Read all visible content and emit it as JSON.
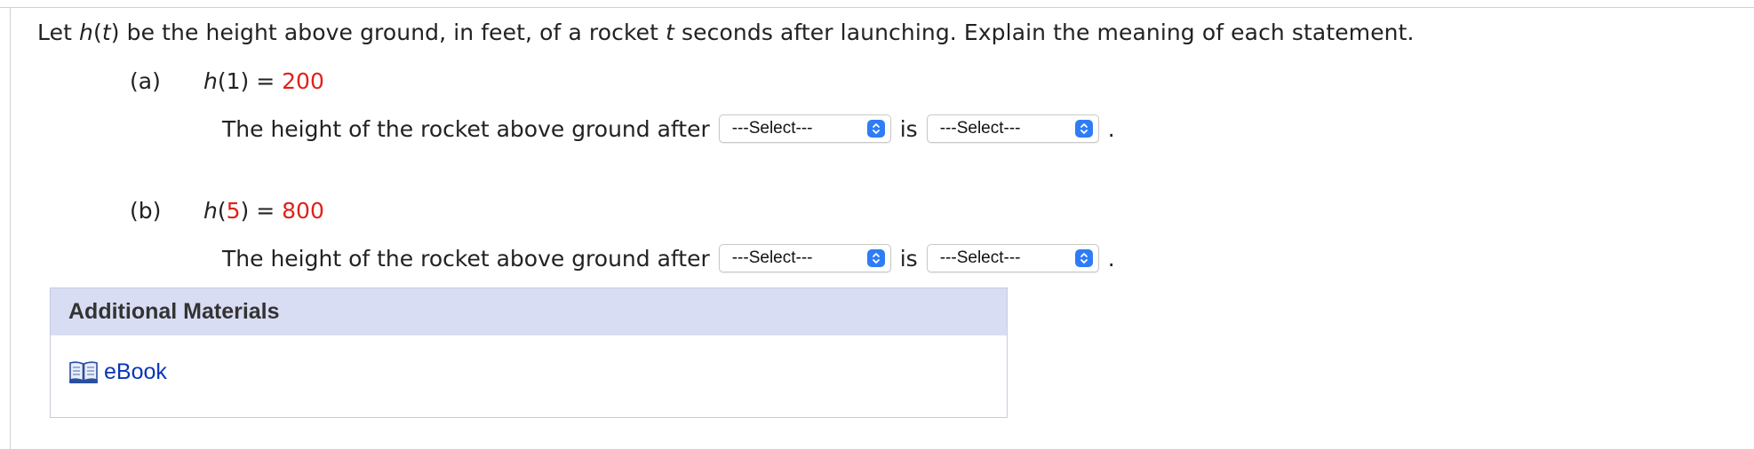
{
  "question": {
    "intro_1": "Let ",
    "h": "h",
    "t": "t",
    "intro_2": " be the height above ground, in feet, of a rocket ",
    "intro_3": " seconds after launching. Explain the meaning of each statement."
  },
  "parts": [
    {
      "label": "(a)",
      "func": "h",
      "arg": "1",
      "equals": " = ",
      "value": "200",
      "statement": "The height of the rocket above ground after",
      "select_1": "---Select---",
      "is_text": "is",
      "select_2": "---Select---",
      "period": "."
    },
    {
      "label": "(b)",
      "func": "h",
      "arg": "5",
      "equals": " = ",
      "value": "800",
      "statement": "The height of the rocket above ground after",
      "select_1": "---Select---",
      "is_text": "is",
      "select_2": "---Select---",
      "period": "."
    }
  ],
  "materials": {
    "header": "Additional Materials",
    "link_label": "eBook",
    "link_icon": "book-icon"
  },
  "colors": {
    "answer_red": "#e0211b",
    "header_bg": "#d8ddf3",
    "link_blue": "#0b35b9",
    "select_arrow_blue": "#2f7cf6"
  }
}
